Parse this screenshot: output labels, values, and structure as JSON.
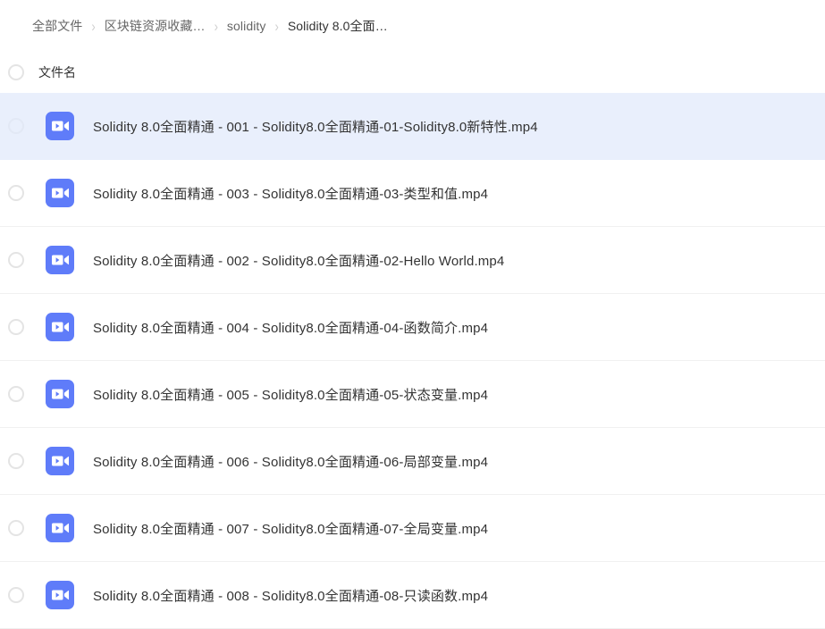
{
  "breadcrumb": {
    "separator": "›",
    "items": [
      {
        "label": "全部文件",
        "current": false
      },
      {
        "label": "区块链资源收藏…",
        "current": false
      },
      {
        "label": "solidity",
        "current": false
      },
      {
        "label": "Solidity 8.0全面…",
        "current": true
      }
    ]
  },
  "list_header": {
    "select_all": "select-all-checkbox",
    "name_column": "文件名"
  },
  "icons": {
    "file_type": "video-file-icon",
    "accent_color": "#5f7cf9",
    "selected_row_color": "#e9effc"
  },
  "files": [
    {
      "name": "Solidity 8.0全面精通 - 001 - Solidity8.0全面精通-01-Solidity8.0新特性.mp4",
      "selected": true
    },
    {
      "name": "Solidity 8.0全面精通 - 003 - Solidity8.0全面精通-03-类型和值.mp4",
      "selected": false
    },
    {
      "name": "Solidity 8.0全面精通 - 002 - Solidity8.0全面精通-02-Hello World.mp4",
      "selected": false
    },
    {
      "name": "Solidity 8.0全面精通 - 004 - Solidity8.0全面精通-04-函数简介.mp4",
      "selected": false
    },
    {
      "name": "Solidity 8.0全面精通 - 005 - Solidity8.0全面精通-05-状态变量.mp4",
      "selected": false
    },
    {
      "name": "Solidity 8.0全面精通 - 006 - Solidity8.0全面精通-06-局部变量.mp4",
      "selected": false
    },
    {
      "name": "Solidity 8.0全面精通 - 007 - Solidity8.0全面精通-07-全局变量.mp4",
      "selected": false
    },
    {
      "name": "Solidity 8.0全面精通 - 008 - Solidity8.0全面精通-08-只读函数.mp4",
      "selected": false
    }
  ]
}
